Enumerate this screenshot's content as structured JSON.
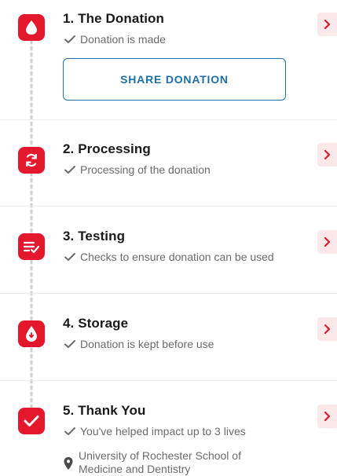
{
  "steps": [
    {
      "title": "1. The Donation",
      "status": "Donation is made",
      "icon": "blood-drop-icon"
    },
    {
      "title": "2. Processing",
      "status": "Processing of the donation",
      "icon": "refresh-icon"
    },
    {
      "title": "3. Testing",
      "status": "Checks to ensure donation can be used",
      "icon": "checklist-icon"
    },
    {
      "title": "4. Storage",
      "status": "Donation is kept before use",
      "icon": "storage-drop-icon"
    },
    {
      "title": "5. Thank You",
      "status": "You've helped impact up to 3 lives",
      "icon": "checkmark-icon"
    }
  ],
  "share_button": {
    "label": "SHARE DONATION"
  },
  "location": {
    "line1": "University of Rochester School of",
    "line2": "Medicine and Dentistry"
  },
  "colors": {
    "accent": "#e3182d",
    "link": "#1d6fa5",
    "status_text": "#6b6b6b"
  }
}
